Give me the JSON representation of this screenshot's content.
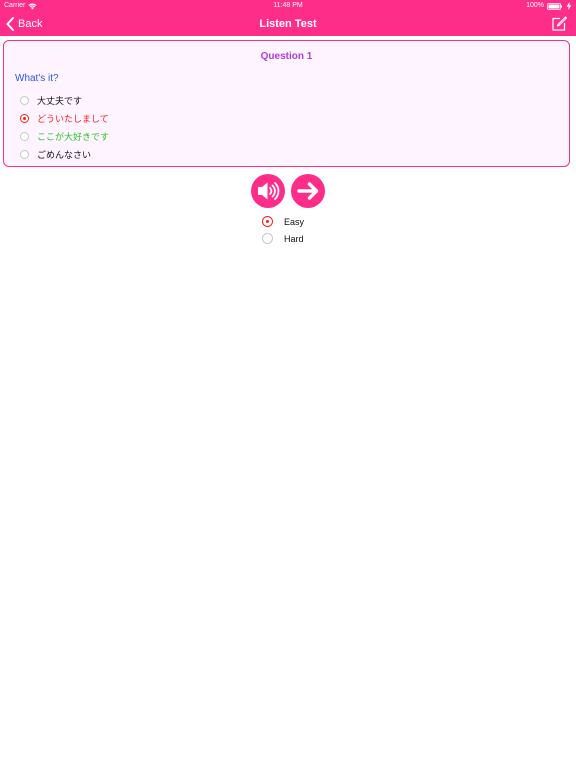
{
  "status_bar": {
    "carrier": "Carrier",
    "time": "11:48 PM",
    "battery": "100%"
  },
  "nav": {
    "back_label": "Back",
    "title": "Listen Test",
    "edit_icon": "compose-icon"
  },
  "colors": {
    "accent": "#ff2d8a",
    "question_title": "#b23dd9",
    "prompt": "#2b55e6",
    "wrong": "#ff1a1a",
    "correct": "#29c429"
  },
  "question": {
    "title": "Question 1",
    "prompt": "What's it?",
    "options": [
      {
        "label": "大丈夫です",
        "state": "normal"
      },
      {
        "label": "どういたしまして",
        "state": "selected-wrong"
      },
      {
        "label": "ここが大好きです",
        "state": "correct"
      },
      {
        "label": "ごめんなさい",
        "state": "normal"
      }
    ]
  },
  "controls": {
    "speaker_icon": "speaker-icon",
    "next_icon": "arrow-right-icon"
  },
  "difficulty": {
    "options": [
      {
        "label": "Easy",
        "selected": true
      },
      {
        "label": "Hard",
        "selected": false
      }
    ]
  }
}
